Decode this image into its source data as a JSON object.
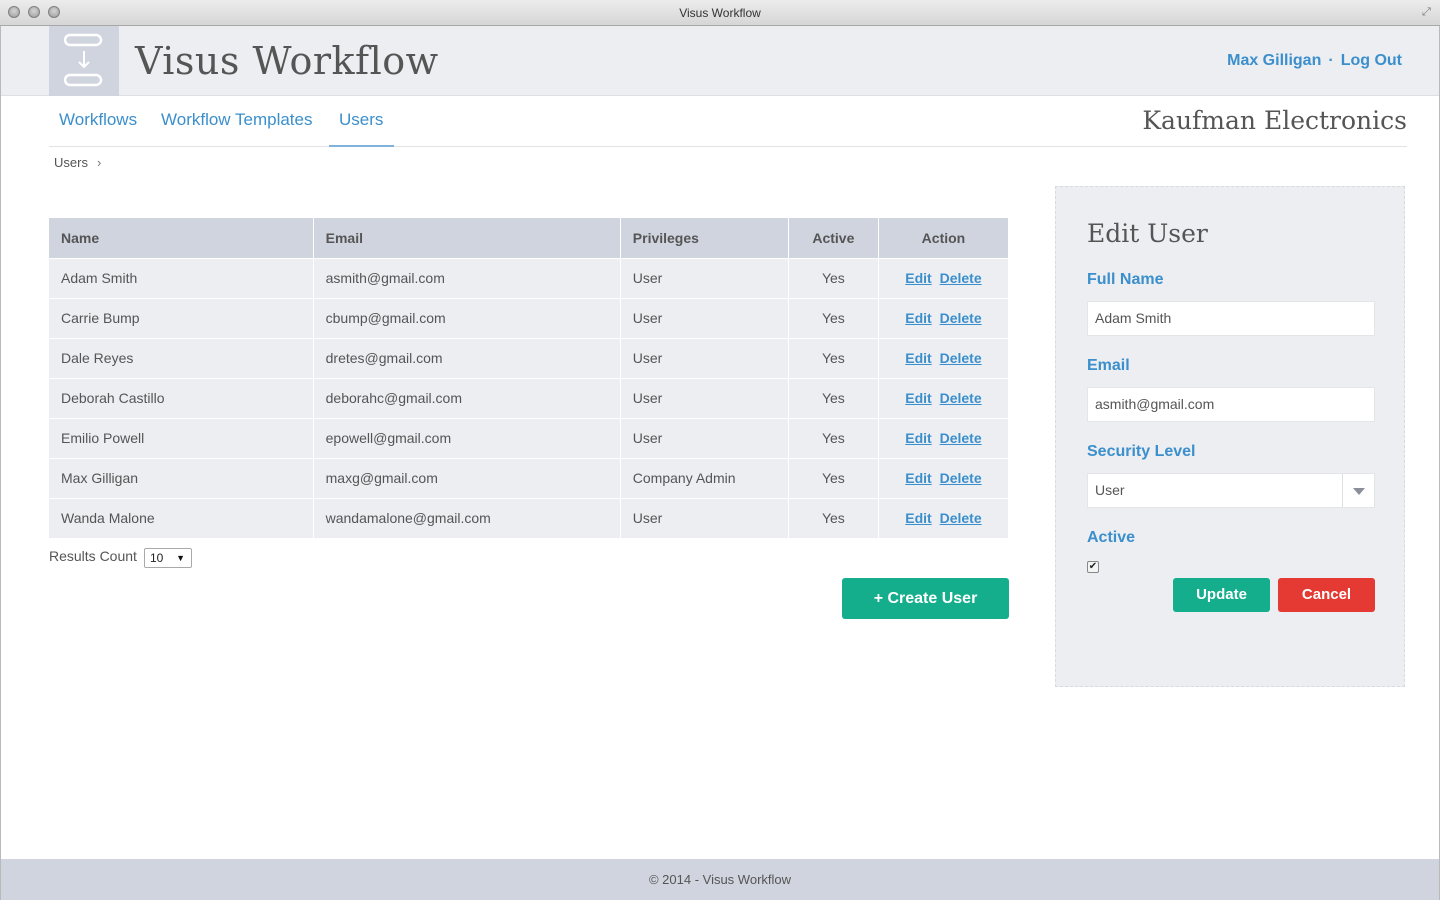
{
  "window": {
    "title": "Visus Workflow"
  },
  "header": {
    "app_name": "Visus Workflow",
    "user_name": "Max Gilligan",
    "separator": "·",
    "logout": "Log Out"
  },
  "nav": {
    "tabs": [
      {
        "label": "Workflows"
      },
      {
        "label": "Workflow Templates"
      },
      {
        "label": "Users"
      }
    ],
    "active_tab": "Users",
    "company": "Kaufman Electronics"
  },
  "breadcrumb": {
    "label": "Users"
  },
  "table": {
    "columns": [
      "Name",
      "Email",
      "Privileges",
      "Active",
      "Action"
    ],
    "edit_label": "Edit",
    "delete_label": "Delete",
    "rows": [
      {
        "name": "Adam Smith",
        "email": "asmith@gmail.com",
        "privileges": "User",
        "active": "Yes"
      },
      {
        "name": "Carrie Bump",
        "email": "cbump@gmail.com",
        "privileges": "User",
        "active": "Yes"
      },
      {
        "name": "Dale Reyes",
        "email": "dretes@gmail.com",
        "privileges": "User",
        "active": "Yes"
      },
      {
        "name": "Deborah Castillo",
        "email": "deborahc@gmail.com",
        "privileges": "User",
        "active": "Yes"
      },
      {
        "name": "Emilio Powell",
        "email": "epowell@gmail.com",
        "privileges": "User",
        "active": "Yes"
      },
      {
        "name": "Max Gilligan",
        "email": "maxg@gmail.com",
        "privileges": "Company Admin",
        "active": "Yes"
      },
      {
        "name": "Wanda Malone",
        "email": "wandamalone@gmail.com",
        "privileges": "User",
        "active": "Yes"
      }
    ]
  },
  "results": {
    "label": "Results Count",
    "value": "10"
  },
  "create_button": "+ Create User",
  "edit_panel": {
    "title": "Edit User",
    "full_name_label": "Full Name",
    "full_name_value": "Adam Smith",
    "email_label": "Email",
    "email_value": "asmith@gmail.com",
    "security_label": "Security Level",
    "security_value": "User",
    "active_label": "Active",
    "active_checked": true,
    "update_label": "Update",
    "cancel_label": "Cancel"
  },
  "footer": {
    "text": "© 2014 - Visus Workflow"
  },
  "colors": {
    "accent_blue": "#3b8fcc",
    "primary_green": "#14ae8c",
    "danger_red": "#e53a33",
    "header_bg": "#eceef2",
    "table_header_bg": "#cfd4de"
  },
  "icons": {
    "logo": "workflow-logo-icon",
    "breadcrumb_chevron": "chevron-right-icon",
    "select_caret": "caret-down-icon"
  }
}
